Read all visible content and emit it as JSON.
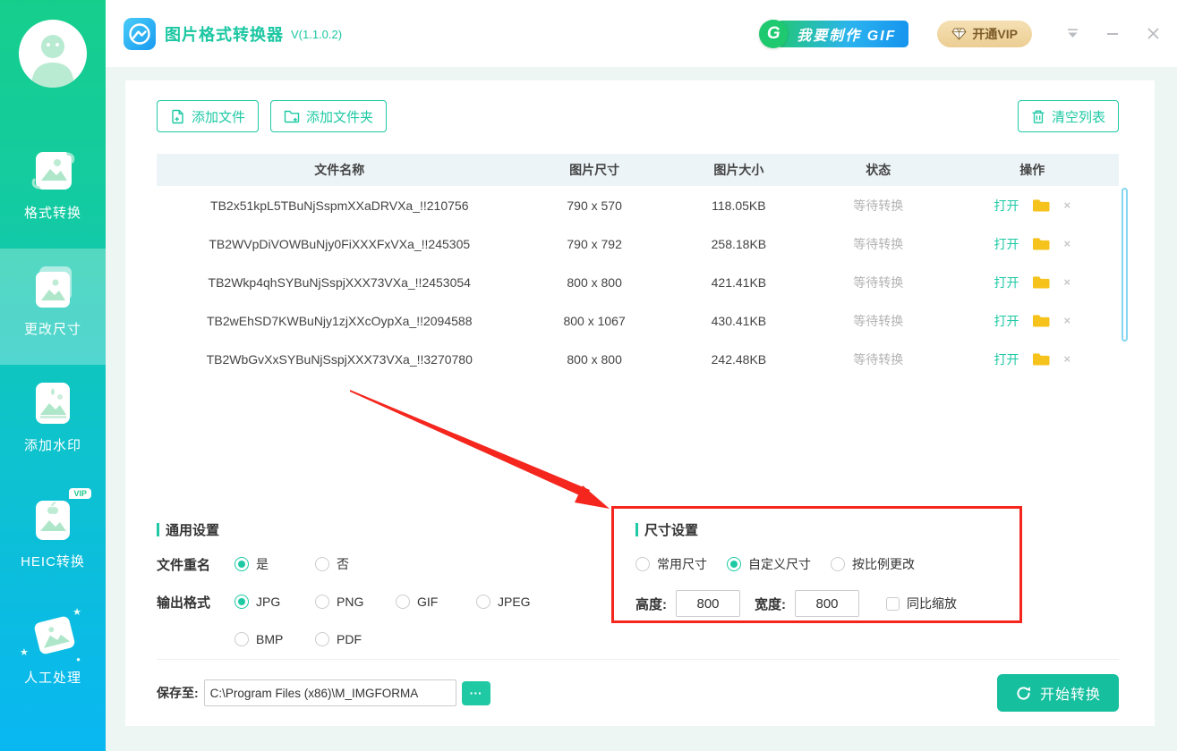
{
  "window": {
    "title": "图片格式转换器",
    "version": "V(1.1.0.2)",
    "gif_button": "我要制作 GIF",
    "gif_logo": "G",
    "vip_button": "开通VIP"
  },
  "sidebar": {
    "items": [
      {
        "label": "格式转换",
        "active": false
      },
      {
        "label": "更改尺寸",
        "active": true
      },
      {
        "label": "添加水印",
        "active": false
      },
      {
        "label": "HEIC转换",
        "active": false,
        "badge": "VIP"
      },
      {
        "label": "人工处理",
        "active": false
      }
    ]
  },
  "toolbar": {
    "add_file": "添加文件",
    "add_folder": "添加文件夹",
    "clear_list": "清空列表"
  },
  "table": {
    "headers": [
      "文件名称",
      "图片尺寸",
      "图片大小",
      "状态",
      "操作"
    ],
    "open_label": "打开",
    "rows": [
      {
        "name": "TB2x51kpL5TBuNjSspmXXaDRVXa_!!210756",
        "dims": "790 x 570",
        "size": "118.05KB",
        "status": "等待转换"
      },
      {
        "name": "TB2WVpDiVOWBuNjy0FiXXXFxVXa_!!245305",
        "dims": "790 x 792",
        "size": "258.18KB",
        "status": "等待转换"
      },
      {
        "name": "TB2Wkp4qhSYBuNjSspjXXX73VXa_!!2453054",
        "dims": "800 x 800",
        "size": "421.41KB",
        "status": "等待转换"
      },
      {
        "name": "TB2wEhSD7KWBuNjy1zjXXcOypXa_!!2094588",
        "dims": "800 x 1067",
        "size": "430.41KB",
        "status": "等待转换"
      },
      {
        "name": "TB2WbGvXxSYBuNjSspjXXX73VXa_!!3270780",
        "dims": "800 x 800",
        "size": "242.48KB",
        "status": "等待转换"
      }
    ]
  },
  "settings_general": {
    "title": "通用设置",
    "rename_label": "文件重名",
    "rename_options": [
      "是",
      "否"
    ],
    "rename_selected": "是",
    "format_label": "输出格式",
    "format_options": [
      "JPG",
      "PNG",
      "GIF",
      "JPEG",
      "BMP",
      "PDF"
    ],
    "format_selected": "JPG"
  },
  "settings_size": {
    "title": "尺寸设置",
    "mode_options": [
      "常用尺寸",
      "自定义尺寸",
      "按比例更改"
    ],
    "mode_selected": "自定义尺寸",
    "height_label": "高度:",
    "height_value": "800",
    "width_label": "宽度:",
    "width_value": "800",
    "scale_checkbox_label": "同比缩放",
    "scale_checked": false
  },
  "save": {
    "label": "保存至:",
    "path": "C:\\Program Files (x86)\\M_IMGFORMA",
    "browse": "···"
  },
  "convert_button": "开始转换",
  "colors": {
    "accent": "#1ec9a4",
    "sidebar_top": "#16ce8c",
    "sidebar_bottom": "#09b7f2",
    "folder_icon": "#f6c21c",
    "annotation_red": "#f4261d",
    "table_header_bg": "#edf4f7",
    "vip_bg": "#eed1a0"
  }
}
